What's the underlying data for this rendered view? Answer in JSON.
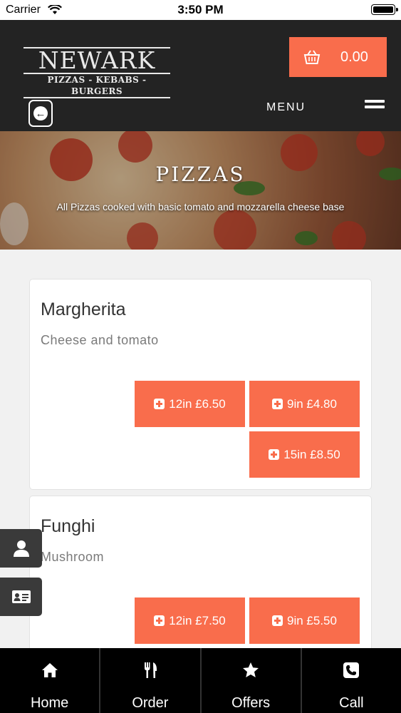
{
  "status_bar": {
    "carrier": "Carrier",
    "time": "3:50 PM"
  },
  "header": {
    "logo_name": "NEWARK",
    "logo_tagline": "PIZZAS - KEBABS - BURGERS",
    "cart_total": "0.00",
    "menu_label": "MENU"
  },
  "hero": {
    "title": "PIZZAS",
    "subtitle": "All Pizzas cooked with basic tomato and mozzarella cheese base"
  },
  "products": [
    {
      "name": "Margherita",
      "description": "Cheese and tomato",
      "options": [
        "12in £6.50",
        "9in £4.80",
        "15in £8.50"
      ]
    },
    {
      "name": "Funghi",
      "description": "Mushroom",
      "options": [
        "12in £7.50",
        "9in £5.50"
      ]
    }
  ],
  "bottom_nav": [
    {
      "label": "Home",
      "icon": "home-icon"
    },
    {
      "label": "Order",
      "icon": "fork-knife-icon"
    },
    {
      "label": "Offers",
      "icon": "star-icon"
    },
    {
      "label": "Call",
      "icon": "phone-icon"
    }
  ],
  "colors": {
    "accent": "#f96d4c",
    "header_bg": "#232323",
    "nav_bg": "#000000"
  }
}
